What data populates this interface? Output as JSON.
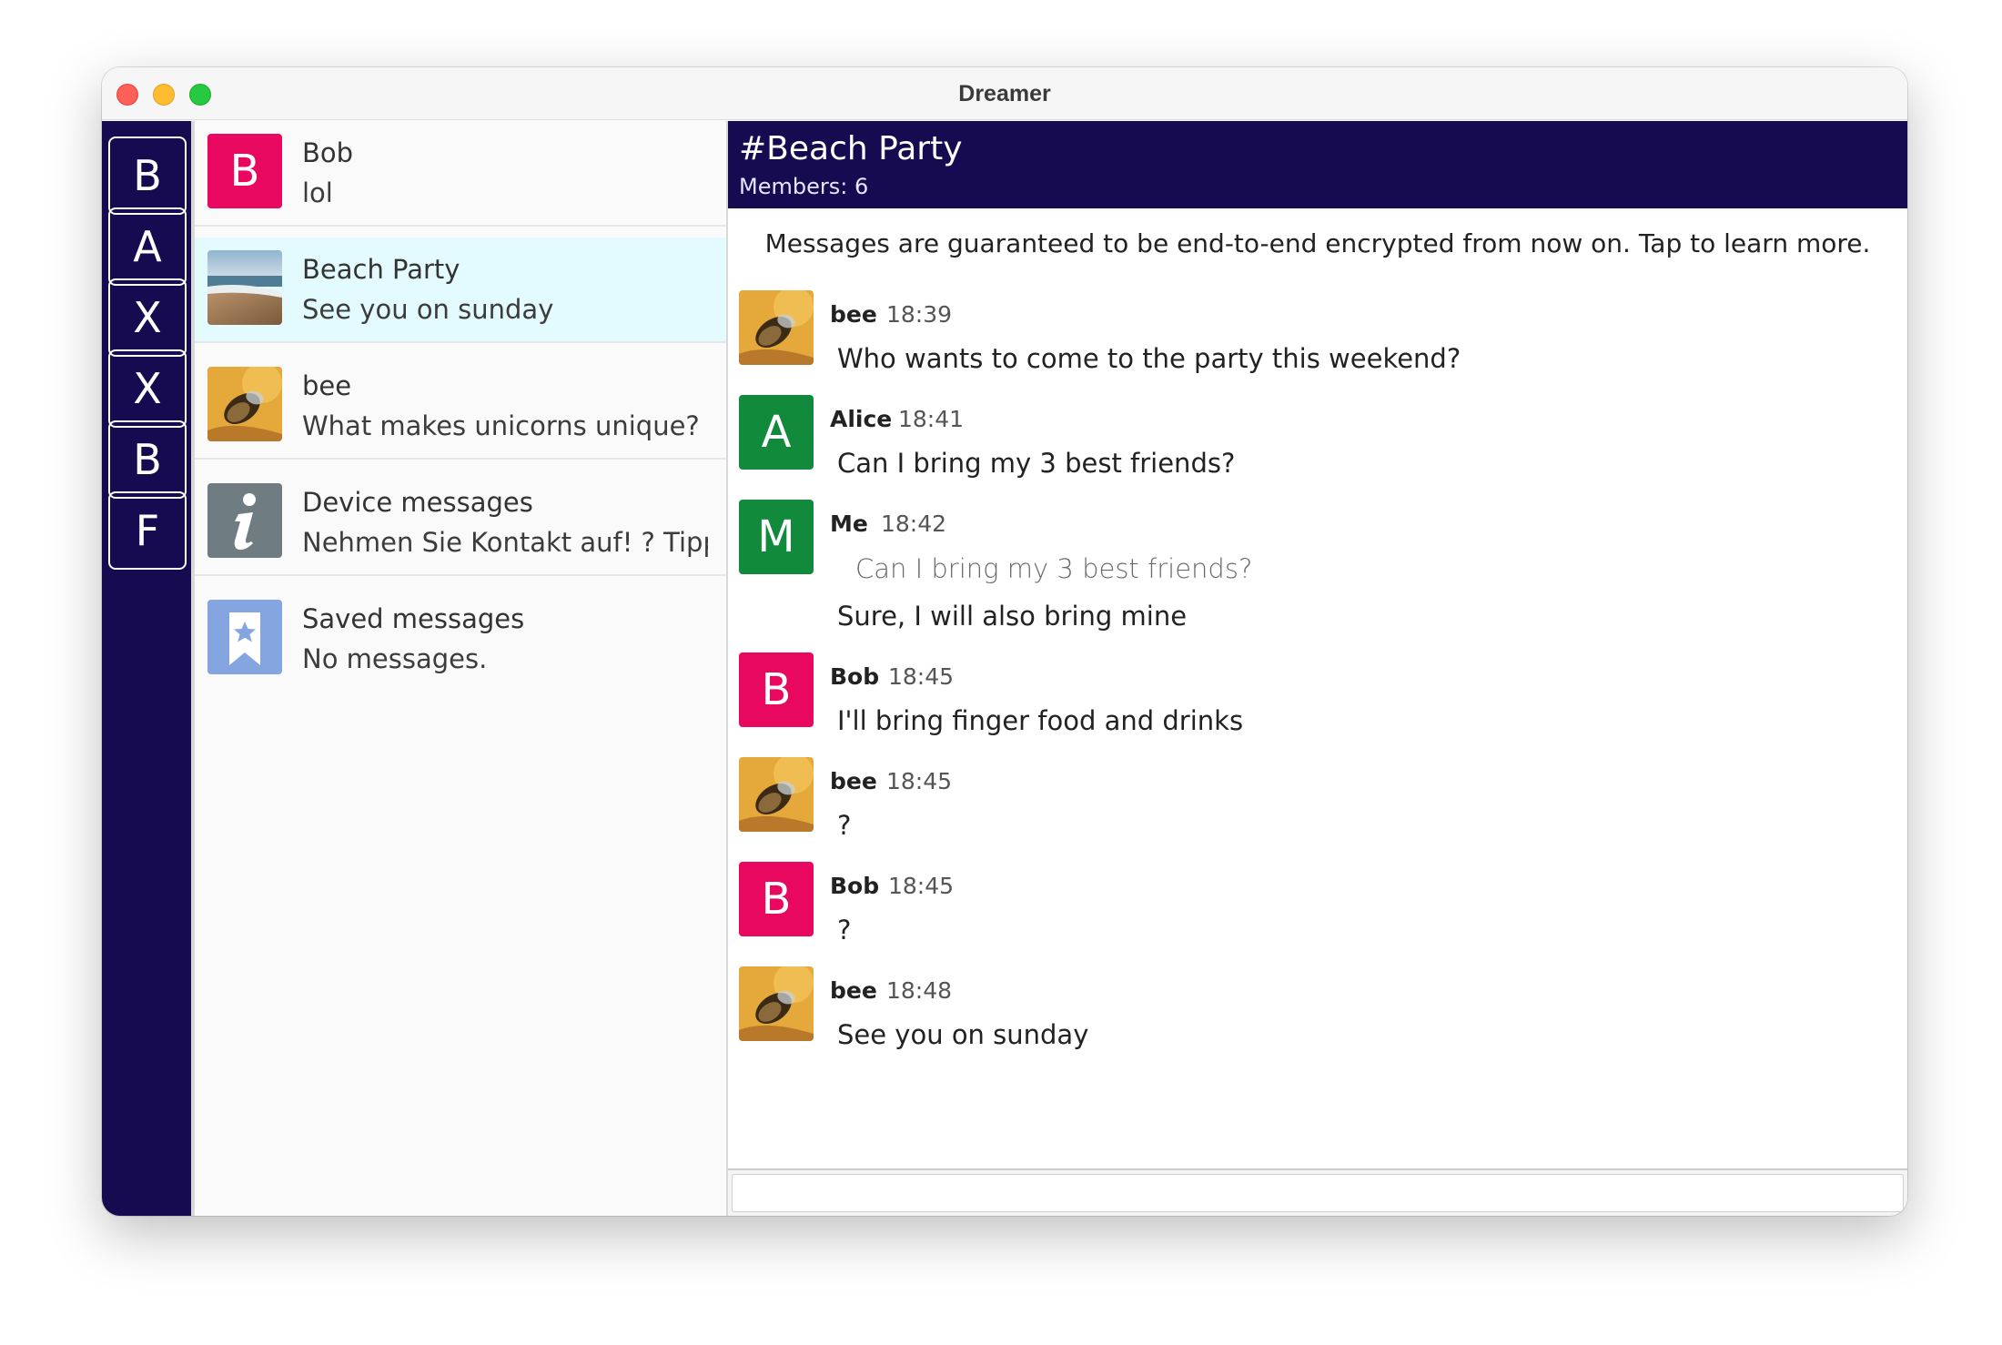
{
  "window": {
    "title": "Dreamer"
  },
  "accounts": [
    {
      "letter": "B"
    },
    {
      "letter": "A"
    },
    {
      "letter": "X"
    },
    {
      "letter": "X"
    },
    {
      "letter": "B"
    },
    {
      "letter": "F"
    }
  ],
  "chats": [
    {
      "name": "Bob",
      "preview": "lol",
      "avatar": "letter",
      "letter": "B",
      "color": "#e8085f"
    },
    {
      "name": "Beach Party",
      "preview": "See you on sunday",
      "avatar": "beach-photo",
      "selected": true
    },
    {
      "name": "bee",
      "preview": "What makes unicorns unique?",
      "avatar": "bee-photo"
    },
    {
      "name": "Device messages",
      "preview": "Nehmen Sie Kontakt auf! ? Tipp ...",
      "avatar": "info-icon",
      "color": "#6f7d83"
    },
    {
      "name": "Saved messages",
      "preview": "No messages.",
      "avatar": "bookmark-icon",
      "color": "#85a5e0"
    }
  ],
  "conversation": {
    "title": "#Beach Party",
    "members": "Members: 6",
    "encryption_notice": "Messages are guaranteed to be end-to-end encrypted from now on. Tap to learn more.",
    "messages": [
      {
        "author": "bee",
        "time": "18:39",
        "text": "Who wants to come to the party this weekend?",
        "avatar": "bee-photo"
      },
      {
        "author": "Alice",
        "time": "18:41",
        "text": "Can I bring my 3 best friends?",
        "avatar": "letter",
        "letter": "A",
        "color": "#118a3c"
      },
      {
        "author": "Me",
        "time": "18:42",
        "quote": "Can I bring my 3 best friends?",
        "text": "Sure, I will also bring mine",
        "avatar": "letter",
        "letter": "M",
        "color": "#118a3c"
      },
      {
        "author": "Bob",
        "time": "18:45",
        "text": "I'll bring finger food and drinks",
        "avatar": "letter",
        "letter": "B",
        "color": "#e8085f"
      },
      {
        "author": "bee",
        "time": "18:45",
        "text": "?",
        "avatar": "bee-photo"
      },
      {
        "author": "Bob",
        "time": "18:45",
        "text": "?",
        "avatar": "letter",
        "letter": "B",
        "color": "#e8085f"
      },
      {
        "author": "bee",
        "time": "18:48",
        "text": "See you on sunday",
        "avatar": "bee-photo"
      }
    ]
  },
  "composer": {
    "value": "",
    "placeholder": ""
  },
  "colors": {
    "rail": "#160a50",
    "header": "#160a50",
    "selected_chat": "#e3fbff"
  }
}
